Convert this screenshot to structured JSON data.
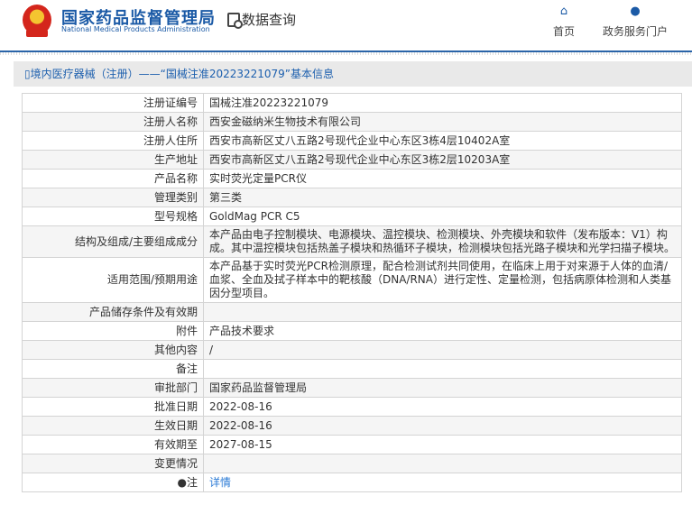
{
  "header": {
    "logo_cn": "国家药品监督管理局",
    "logo_en": "National Medical Products Administration",
    "data_query": "数据查询",
    "nav": [
      {
        "label": "首页",
        "icon": "home-icon"
      },
      {
        "label": "政务服务门户",
        "icon": "user-icon"
      }
    ]
  },
  "breadcrumb": "境内医疗器械（注册）——“国械注准20223221079”基本信息",
  "rows": [
    {
      "label": "注册证编号",
      "value": "国械注准20223221079"
    },
    {
      "label": "注册人名称",
      "value": "西安金磁纳米生物技术有限公司"
    },
    {
      "label": "注册人住所",
      "value": "西安市高新区丈八五路2号现代企业中心东区3栋4层10402A室"
    },
    {
      "label": "生产地址",
      "value": "西安市高新区丈八五路2号现代企业中心东区3栋2层10203A室"
    },
    {
      "label": "产品名称",
      "value": "实时荧光定量PCR仪"
    },
    {
      "label": "管理类别",
      "value": "第三类"
    },
    {
      "label": "型号规格",
      "value": "GoldMag PCR C5"
    },
    {
      "label": "结构及组成/主要组成成分",
      "value": "本产品由电子控制模块、电源模块、温控模块、检测模块、外壳模块和软件（发布版本：V1）构成。其中温控模块包括热盖子模块和热循环子模块，检测模块包括光路子模块和光学扫描子模块。"
    },
    {
      "label": "适用范围/预期用途",
      "value": "本产品基于实时荧光PCR检测原理，配合检测试剂共同使用，在临床上用于对来源于人体的血清/血浆、全血及拭子样本中的靶核酸（DNA/RNA）进行定性、定量检测，包括病原体检测和人类基因分型项目。"
    },
    {
      "label": "产品储存条件及有效期",
      "value": ""
    },
    {
      "label": "附件",
      "value": "产品技术要求"
    },
    {
      "label": "其他内容",
      "value": "/"
    },
    {
      "label": "备注",
      "value": ""
    },
    {
      "label": "审批部门",
      "value": "国家药品监督管理局"
    },
    {
      "label": "批准日期",
      "value": "2022-08-16"
    },
    {
      "label": "生效日期",
      "value": "2022-08-16"
    },
    {
      "label": "有效期至",
      "value": "2027-08-15"
    },
    {
      "label": "变更情况",
      "value": ""
    }
  ],
  "note": {
    "label": "注",
    "link": "详情"
  }
}
